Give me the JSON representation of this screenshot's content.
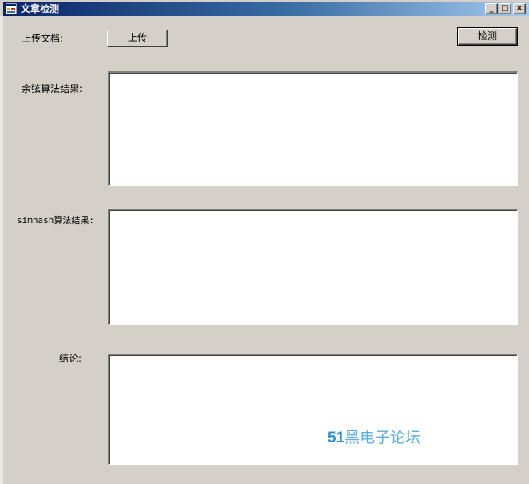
{
  "window": {
    "title": "文章检测",
    "controls": {
      "minimize": "_",
      "maximize": "□",
      "close": "×"
    }
  },
  "form": {
    "upload_label": "上传文档:",
    "upload_button": "上传",
    "detect_button": "检测",
    "cosine_label": "余弦算法结果:",
    "simhash_label": "simhash算法结果:",
    "conclusion_label": "结论:",
    "cosine_result": "",
    "simhash_result": "",
    "conclusion_text": ""
  },
  "watermark": {
    "number": "51",
    "text": "黑电子论坛"
  }
}
